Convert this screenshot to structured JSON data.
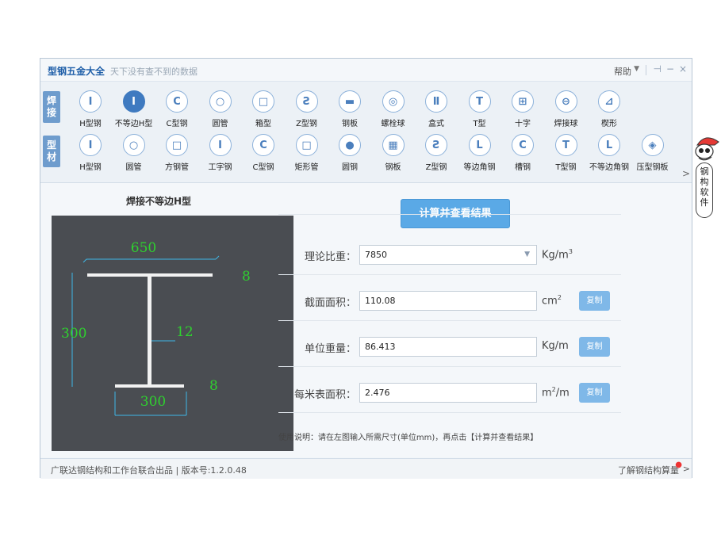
{
  "window": {
    "title": "型钢五金大全",
    "subtitle": "天下没有查不到的数据",
    "help_label": "帮助",
    "controls": [
      "⊣",
      "−",
      "×"
    ]
  },
  "toolbar": {
    "welding_tab": [
      "焊",
      "接"
    ],
    "profile_tab": [
      "型",
      "材"
    ],
    "welding_items": [
      {
        "label": "H型钢",
        "icon": "i-beam-icon",
        "glyph": "I"
      },
      {
        "label": "不等边H型",
        "icon": "unequal-h-beam-icon",
        "glyph": "I",
        "selected": true
      },
      {
        "label": "C型钢",
        "icon": "c-channel-icon",
        "glyph": "C"
      },
      {
        "label": "圆管",
        "icon": "round-tube-icon",
        "glyph": "○"
      },
      {
        "label": "箱型",
        "icon": "box-section-icon",
        "glyph": "□"
      },
      {
        "label": "Z型钢",
        "icon": "z-section-icon",
        "glyph": "Ƨ"
      },
      {
        "label": "钢板",
        "icon": "steel-plate-icon",
        "glyph": "▬"
      },
      {
        "label": "螺栓球",
        "icon": "bolt-ball-icon",
        "glyph": "◎"
      },
      {
        "label": "盒式",
        "icon": "box-type-icon",
        "glyph": "Ⅱ"
      },
      {
        "label": "T型",
        "icon": "t-section-icon",
        "glyph": "T"
      },
      {
        "label": "十字",
        "icon": "cross-section-icon",
        "glyph": "⊞"
      },
      {
        "label": "焊接球",
        "icon": "welded-ball-icon",
        "glyph": "⊖"
      },
      {
        "label": "楔形",
        "icon": "wedge-icon",
        "glyph": "⊿"
      }
    ],
    "profile_items": [
      {
        "label": "H型钢",
        "icon": "i-beam-icon",
        "glyph": "I"
      },
      {
        "label": "圆管",
        "icon": "round-tube-icon",
        "glyph": "○"
      },
      {
        "label": "方钢管",
        "icon": "square-tube-icon",
        "glyph": "□"
      },
      {
        "label": "工字钢",
        "icon": "i-steel-icon",
        "glyph": "I"
      },
      {
        "label": "C型钢",
        "icon": "c-channel-icon",
        "glyph": "C"
      },
      {
        "label": "矩形管",
        "icon": "rect-tube-icon",
        "glyph": "□"
      },
      {
        "label": "圆钢",
        "icon": "round-bar-icon",
        "glyph": "●"
      },
      {
        "label": "钢板",
        "icon": "steel-plate-icon",
        "glyph": "▦"
      },
      {
        "label": "Z型钢",
        "icon": "z-section-icon",
        "glyph": "Ƨ"
      },
      {
        "label": "等边角钢",
        "icon": "equal-angle-icon",
        "glyph": "L"
      },
      {
        "label": "槽钢",
        "icon": "channel-icon",
        "glyph": "C"
      },
      {
        "label": "T型钢",
        "icon": "t-section-icon",
        "glyph": "T"
      },
      {
        "label": "不等边角钢",
        "icon": "unequal-angle-icon",
        "glyph": "L"
      },
      {
        "label": "压型钢板",
        "icon": "profiled-sheet-icon",
        "glyph": "◈"
      }
    ],
    "more_arrow": ">"
  },
  "figure": {
    "title": "焊接不等边H型",
    "dims": {
      "top_width": "650",
      "top_thickness": "8",
      "height": "300",
      "web_thickness": "12",
      "bottom_thickness": "8",
      "bottom_width": "300"
    }
  },
  "calc": {
    "button_label": "计算并查看结果",
    "rows": [
      {
        "label": "理论比重：",
        "value": "7850",
        "unit": "Kg/m",
        "unit_sup": "3",
        "has_dropdown": true,
        "has_copy": false
      },
      {
        "label": "截面面积：",
        "value": "110.08",
        "unit": "cm",
        "unit_sup": "2",
        "has_dropdown": false,
        "has_copy": true
      },
      {
        "label": "单位重量：",
        "value": "86.413",
        "unit": "Kg/m",
        "unit_sup": "",
        "has_dropdown": false,
        "has_copy": true
      },
      {
        "label": "每米表面积：",
        "value": "2.476",
        "unit": "m",
        "unit_sup": "2",
        "unit_after": "/m",
        "has_dropdown": false,
        "has_copy": true
      }
    ],
    "copy_label": "复制",
    "usage": "使用说明：请在左图输入所需尺寸(单位mm)，再点击【计算并查看结果】"
  },
  "status": {
    "left": "广联达钢结构和工作台联合出品 | 版本号:1.2.0.48",
    "right": "了解钢结构算量",
    "arrow": ">"
  },
  "mascot": {
    "tag": [
      "钢",
      "构",
      "软",
      "件"
    ]
  },
  "colors": {
    "accent": "#3f7ac0",
    "button": "#5aa9e6",
    "dimension_text": "#2fd02f",
    "canvas_bg": "#4a4d52"
  }
}
